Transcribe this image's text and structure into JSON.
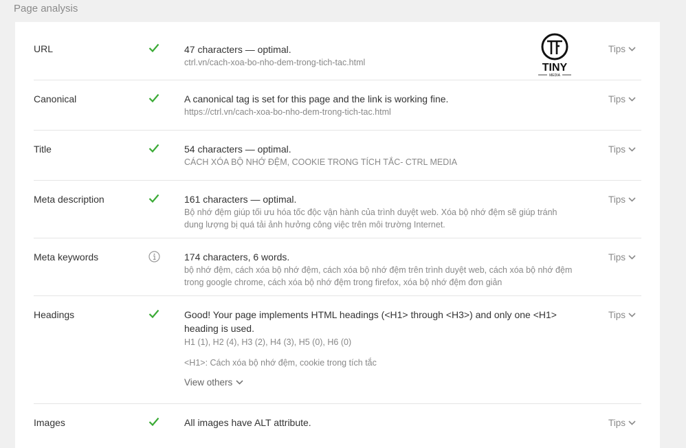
{
  "header": {
    "title": "Page analysis"
  },
  "colors": {
    "check": "#3aaa35",
    "info": "#999999"
  },
  "logo": {
    "text": "TINY",
    "sub": "MEDIA"
  },
  "rows": [
    {
      "label": "URL",
      "status": "check-icon",
      "main": "47 characters — optimal.",
      "sub": "ctrl.vn/cach-xoa-bo-nho-dem-trong-tich-tac.html",
      "tips": "Tips"
    },
    {
      "label": "Canonical",
      "status": "check-icon",
      "main": "A canonical tag is set for this page and the link is working fine.",
      "sub": "https://ctrl.vn/cach-xoa-bo-nho-dem-trong-tich-tac.html",
      "tips": "Tips"
    },
    {
      "label": "Title",
      "status": "check-icon",
      "main": "54 characters — optimal.",
      "sub": "CÁCH XÓA BỘ NHỚ ĐỆM, COOKIE TRONG TÍCH TẮC- CTRL MEDIA",
      "tips": "Tips"
    },
    {
      "label": "Meta description",
      "status": "check-icon",
      "main": "161 characters — optimal.",
      "sub": "Bộ nhớ đệm giúp tối ưu hóa tốc độc vận hành của trình duyệt web. Xóa bộ nhớ đệm sẽ giúp tránh dung lượng bị quá tải ảnh hưởng công việc trên môi trường Internet.",
      "tips": "Tips"
    },
    {
      "label": "Meta keywords",
      "status": "info-icon",
      "main": "174 characters, 6 words.",
      "sub": "bộ nhớ đệm, cách xóa bộ nhớ đệm, cách xóa bộ nhớ đệm trên trình duyệt web, cách xóa bộ nhớ đệm trong google chrome, cách xóa bộ nhớ đệm trong firefox, xóa bộ nhớ đệm đơn giản",
      "tips": "Tips"
    },
    {
      "label": "Headings",
      "status": "check-icon",
      "main": "Good! Your page implements HTML headings (<H1> through <H3>) and only one <H1> heading is used.",
      "sub": "H1 (1), H2 (4), H3 (2), H4 (3), H5 (0), H6 (0)",
      "sub2": "<H1>: Cách xóa bộ nhớ đệm, cookie trong tích tắc",
      "view_others": "View others",
      "tips": "Tips"
    },
    {
      "label": "Images",
      "status": "check-icon",
      "main": "All images have ALT attribute.",
      "tips": "Tips"
    }
  ]
}
